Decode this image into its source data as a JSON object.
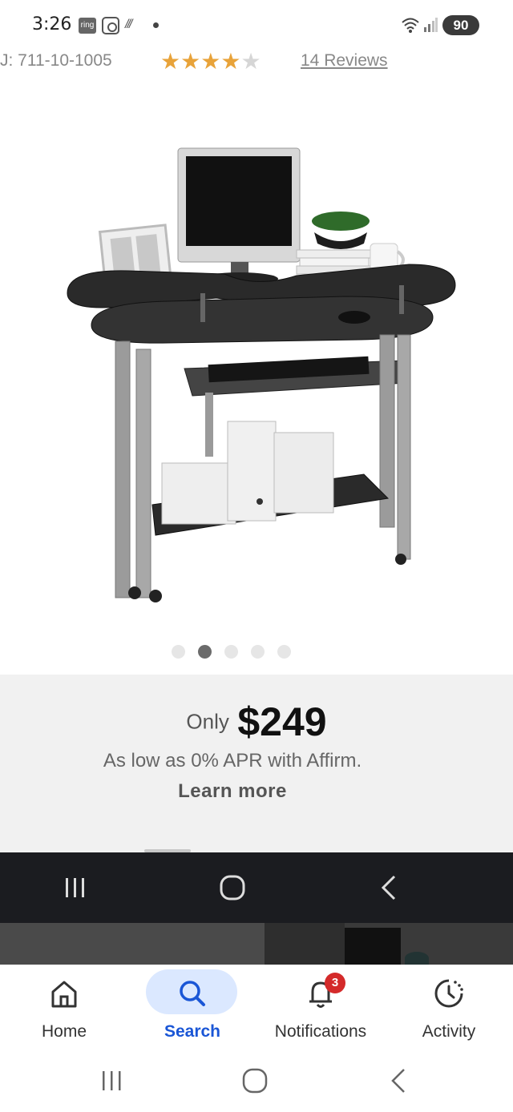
{
  "status_bar": {
    "time": "3:26",
    "ring_label": "ring",
    "battery": "90"
  },
  "product": {
    "sku": "J: 711-10-1005",
    "rating": 4,
    "rating_max": 5,
    "reviews_label": "14 Reviews",
    "image_icon": "computer-desk-photo",
    "carousel": {
      "count": 5,
      "active_index": 1
    }
  },
  "pricing": {
    "prefix": "Only",
    "price": "$249",
    "financing_text": "As low as 0% APR with Affirm.",
    "learn_more": "Learn more"
  },
  "bottom_tabs": [
    {
      "label": "Home",
      "icon": "home-icon"
    },
    {
      "label": "Search",
      "icon": "search-icon",
      "active": true
    },
    {
      "label": "Notifications",
      "icon": "bell-icon",
      "badge": "3"
    },
    {
      "label": "Activity",
      "icon": "activity-icon"
    }
  ],
  "colors": {
    "accent": "#1a56d6",
    "accent_bg": "#dbe8ff",
    "star": "#e8a33a",
    "badge": "#d42a2a",
    "nav_dark": "#1b1c20"
  }
}
